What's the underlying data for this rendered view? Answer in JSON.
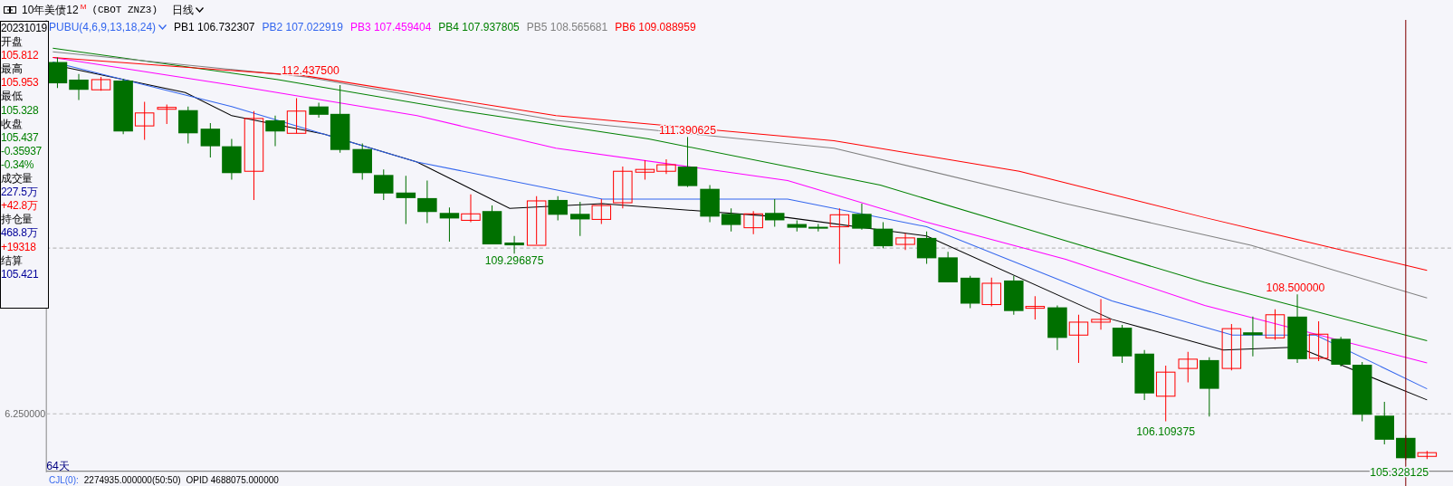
{
  "title_bar": {
    "name": "10年美债12",
    "badge": "M",
    "code": "(CBOT ZNZ3)",
    "period": "日线"
  },
  "info_panel": {
    "date": "20231019",
    "fields": [
      {
        "label": "开盘",
        "values": [
          {
            "text": "105.812",
            "color": "#ff0000"
          }
        ]
      },
      {
        "label": "最高",
        "values": [
          {
            "text": "105.953",
            "color": "#ff0000"
          }
        ]
      },
      {
        "label": "最低",
        "values": [
          {
            "text": "105.328",
            "color": "#008000"
          }
        ]
      },
      {
        "label": "收盘",
        "values": [
          {
            "text": "105.437",
            "color": "#008000"
          },
          {
            "text": "-0.35937",
            "color": "#008000"
          },
          {
            "text": "-0.34%",
            "color": "#008000"
          }
        ]
      },
      {
        "label": "成交量",
        "values": [
          {
            "text": "227.5万",
            "color": "#000099"
          },
          {
            "text": "+42.8万",
            "color": "#ff0000"
          }
        ]
      },
      {
        "label": "持仓量",
        "values": [
          {
            "text": "468.8万",
            "color": "#000099"
          },
          {
            "text": "+19318",
            "color": "#ff0000"
          }
        ]
      },
      {
        "label": "结算",
        "values": [
          {
            "text": "105.421",
            "color": "#000099"
          }
        ]
      }
    ]
  },
  "indicator": {
    "name": "PUBU(4,6,9,13,18,24)",
    "color": "#3366ee"
  },
  "legend": [
    {
      "text": "PB1 106.732307",
      "color": "#000000"
    },
    {
      "text": "PB2 107.022919",
      "color": "#3366ee"
    },
    {
      "text": "PB3 107.459404",
      "color": "#ff00ff"
    },
    {
      "text": "PB4 107.937805",
      "color": "#008000"
    },
    {
      "text": "PB5 108.565681",
      "color": "#808080"
    },
    {
      "text": "PB6 109.088959",
      "color": "#ff0000"
    }
  ],
  "price_labels": [
    {
      "text": "112.437500",
      "color": "#ff0000"
    },
    {
      "text": "111.390625",
      "color": "#ff0000"
    },
    {
      "text": "109.296875",
      "color": "#008000"
    },
    {
      "text": "108.500000",
      "color": "#ff0000"
    },
    {
      "text": "106.109375",
      "color": "#008000"
    },
    {
      "text": "105.328125",
      "color": "#008000"
    }
  ],
  "axis_label": "6.250000",
  "bar_count": "64天",
  "bottom_bar": {
    "name": "CJL(0):",
    "values": [
      "2274935.000000(50:50)",
      "OPID 4688075.000000"
    ]
  }
}
